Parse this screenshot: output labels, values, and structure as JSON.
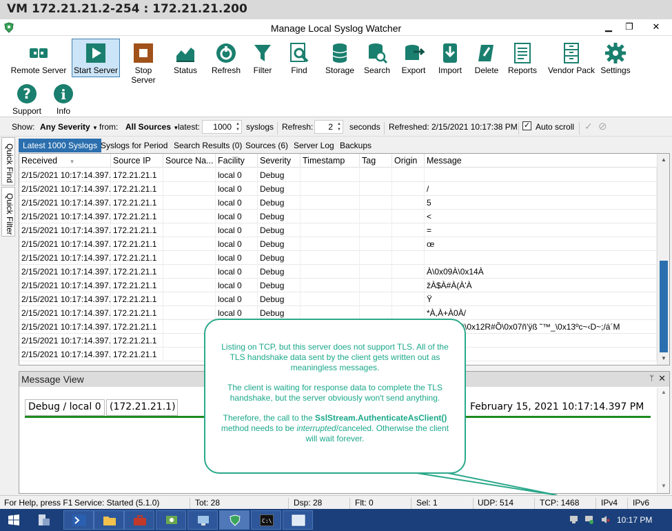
{
  "vm_title": "VM 172.21.21.2-254 : 172.21.21.200",
  "window": {
    "title": "Manage Local Syslog Watcher",
    "min": "▁",
    "max": "❐",
    "close": "✕"
  },
  "ribbon": {
    "buttons": [
      {
        "label": "Remote Server",
        "icon": "plug-icon"
      },
      {
        "label": "Start Server",
        "icon": "play-icon"
      },
      {
        "label": "Stop Server",
        "icon": "stop-icon"
      },
      {
        "label": "Status",
        "icon": "chart-icon"
      },
      {
        "label": "Refresh",
        "icon": "refresh-icon"
      },
      {
        "label": "Filter",
        "icon": "filter-icon"
      },
      {
        "label": "Find",
        "icon": "find-icon"
      },
      {
        "label": "Storage",
        "icon": "database-icon"
      },
      {
        "label": "Search",
        "icon": "database-search-icon"
      },
      {
        "label": "Export",
        "icon": "export-icon"
      },
      {
        "label": "Import",
        "icon": "import-icon"
      },
      {
        "label": "Delete",
        "icon": "delete-icon"
      },
      {
        "label": "Reports",
        "icon": "reports-icon"
      },
      {
        "label": "Vendor Pack",
        "icon": "cabinet-icon"
      },
      {
        "label": "Settings",
        "icon": "gear-icon"
      },
      {
        "label": "Support",
        "icon": "question-icon"
      },
      {
        "label": "Info",
        "icon": "info-icon"
      }
    ]
  },
  "filter": {
    "show_label": "Show:",
    "severity": "Any Severity",
    "from_label": "from:",
    "sources": "All Sources",
    "latest_label": "latest:",
    "latest_value": "1000",
    "syslogs_label": "syslogs",
    "refresh_label": "Refresh:",
    "refresh_value": "2",
    "seconds_label": "seconds",
    "refreshed_label": "Refreshed:",
    "refreshed_value": "2/15/2021 10:17:38 PM",
    "autoscroll_label": "Auto scroll",
    "autoscroll_checked": "✓"
  },
  "side_tabs": [
    "Quick Find",
    "Quick Filter"
  ],
  "tabs": [
    "Latest 1000 Syslogs",
    "Syslogs for Period",
    "Search Results (0)",
    "Sources (6)",
    "Server Log",
    "Backups"
  ],
  "columns": [
    "Received",
    "Source IP",
    "Source Na...",
    "Facility",
    "Severity",
    "Timestamp",
    "Tag",
    "Origin",
    "Message"
  ],
  "rows": [
    [
      "2/15/2021 10:17:14.397...",
      "172.21.21.1",
      "",
      "local 0",
      "Debug",
      "",
      "",
      "",
      ""
    ],
    [
      "2/15/2021 10:17:14.397...",
      "172.21.21.1",
      "",
      "local 0",
      "Debug",
      "",
      "",
      "",
      "/"
    ],
    [
      "2/15/2021 10:17:14.397...",
      "172.21.21.1",
      "",
      "local 0",
      "Debug",
      "",
      "",
      "",
      "5"
    ],
    [
      "2/15/2021 10:17:14.397...",
      "172.21.21.1",
      "",
      "local 0",
      "Debug",
      "",
      "",
      "",
      "<"
    ],
    [
      "2/15/2021 10:17:14.397...",
      "172.21.21.1",
      "",
      "local 0",
      "Debug",
      "",
      "",
      "",
      "="
    ],
    [
      "2/15/2021 10:17:14.397...",
      "172.21.21.1",
      "",
      "local 0",
      "Debug",
      "",
      "",
      "",
      "œ"
    ],
    [
      "2/15/2021 10:17:14.397...",
      "172.21.21.1",
      "",
      "local 0",
      "Debug",
      "",
      "",
      "",
      ""
    ],
    [
      "2/15/2021 10:17:14.397...",
      "172.21.21.1",
      "",
      "local 0",
      "Debug",
      "",
      "",
      "",
      "À\\0x09À\\0x14À"
    ],
    [
      "2/15/2021 10:17:14.397...",
      "172.21.21.1",
      "",
      "local 0",
      "Debug",
      "",
      "",
      "",
      "žÀ$À#À(À'À"
    ],
    [
      "2/15/2021 10:17:14.397...",
      "172.21.21.1",
      "",
      "local 0",
      "Debug",
      "",
      "",
      "",
      "Ÿ"
    ],
    [
      "2/15/2021 10:17:14.397...",
      "172.21.21.1",
      "",
      "local 0",
      "Debug",
      "",
      "",
      "",
      "*À,À+À0À/"
    ],
    [
      "2/15/2021 10:17:14.397...",
      "172.21.21.1",
      "",
      "local 0",
      "Debug",
      "",
      "",
      "",
      "3`+UZ«Aü\\0x12R#Õ\\0x07ñ'ÿß ˜™_\\0x13ºc~‹D~;/á´M"
    ],
    [
      "2/15/2021 10:17:14.397...",
      "172.21.21.1",
      "",
      "",
      "",
      "",
      "",
      "",
      ""
    ],
    [
      "2/15/2021 10:17:14.397...",
      "172.21.21.1",
      "",
      "",
      "",
      "",
      "",
      "",
      ""
    ]
  ],
  "message_view": {
    "title": "Message View",
    "pin": "ᛘ",
    "close": "✕",
    "severity_facility": "Debug / local 0",
    "source": "(172.21.21.1)",
    "date": "February 15, 2021 10:17:14.397 PM"
  },
  "callout": {
    "p1": "Listing on TCP, but this server does not support TLS. All of the TLS handshake data sent by the client gets written out as meaningless messages.",
    "p2": "The client is waiting for response data to complete the TLS handshake, but the server obviously won't send anything.",
    "p3_a": "Therefore, the call to the ",
    "p3_b": "SslStream.AuthenticateAsClient()",
    "p3_c": " method needs to be ",
    "p3_d": "interrupted",
    "p3_e": "/canceled. Otherwise the client will wait forever."
  },
  "status": {
    "help": "For Help, press F1",
    "service": "Service: Started (5.1.0)",
    "tot": "Tot: 28",
    "dsp": "Dsp: 28",
    "flt": "Flt: 0",
    "sel": "Sel: 1",
    "udp": "UDP: 514",
    "tcp": "TCP: 1468",
    "ipv4": "IPv4",
    "ipv6": "IPv6"
  },
  "taskbar": {
    "clock": "10:17 PM"
  },
  "colors": {
    "accent": "#2b6fae",
    "callout": "#2aa88a",
    "selected": "#cce4f7",
    "green": "#1e8a1e"
  }
}
